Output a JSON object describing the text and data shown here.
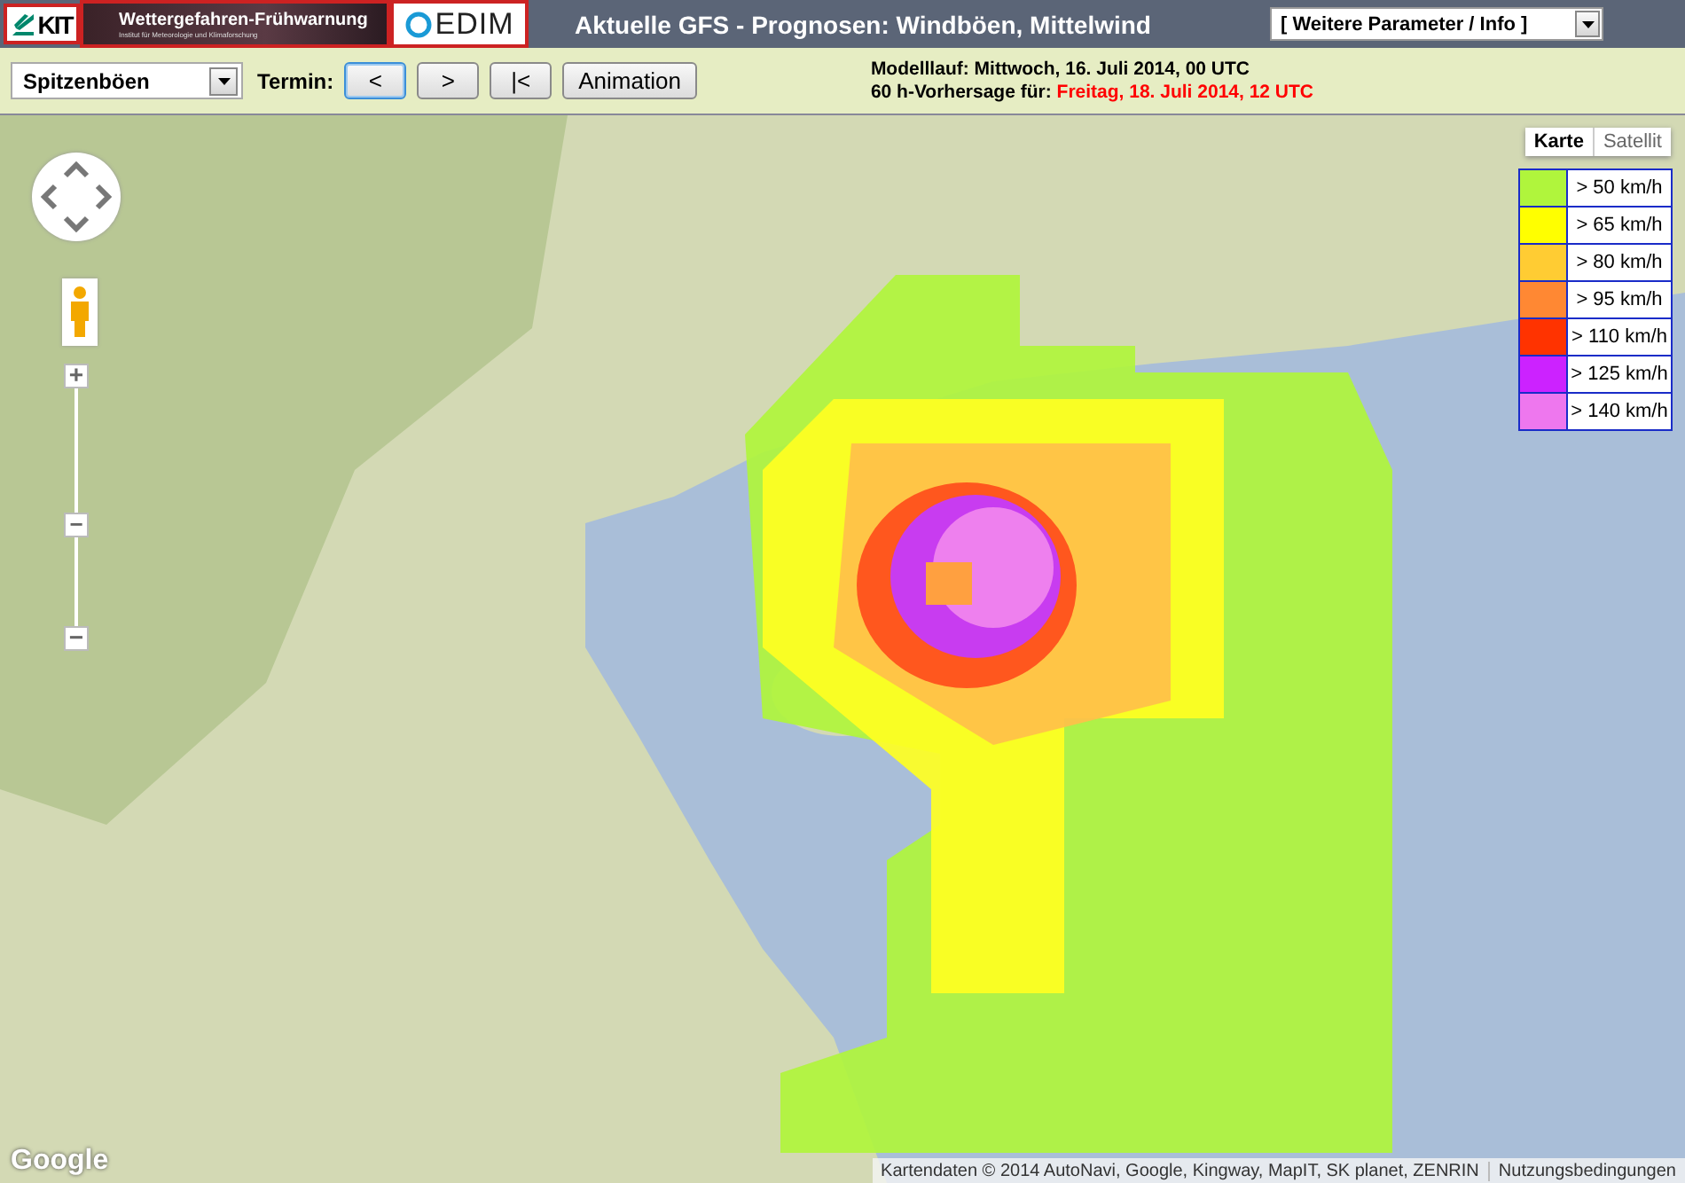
{
  "header": {
    "logos": {
      "kit": "KIT",
      "banner_title": "Wettergefahren-Frühwarnung",
      "banner_subtitle": "Institut für Meteorologie und Klimaforschung",
      "cedim": "EDIM"
    },
    "title": "Aktuelle GFS - Prognosen: Windböen, Mittelwind",
    "dropdown": "[ Weitere Parameter / Info ]"
  },
  "toolbar": {
    "parameter_select": "Spitzenböen",
    "termin_label": "Termin:",
    "buttons": [
      {
        "label": "<",
        "focused": true
      },
      {
        "label": ">",
        "focused": false
      },
      {
        "label": "|<",
        "focused": false
      },
      {
        "label": "Animation",
        "focused": false
      }
    ],
    "model_run_label": "Modelllauf:",
    "model_run": "Mittwoch, 16. Juli 2014, 00 UTC",
    "forecast_label": "60 h-Vorhersage für:",
    "forecast_time": "Freitag, 18. Juli 2014, 12 UTC"
  },
  "map": {
    "zoom": {
      "plus": "+",
      "minus": "−",
      "level": 0.42
    },
    "map_types": [
      {
        "label": "Karte",
        "selected": true
      },
      {
        "label": "Satellit",
        "selected": false
      }
    ],
    "legend": [
      {
        "label": "> 50 km/h",
        "color": "#b0f53c"
      },
      {
        "label": "> 65 km/h",
        "color": "#ffff00"
      },
      {
        "label": "> 80 km/h",
        "color": "#ffcc33"
      },
      {
        "label": "> 95 km/h",
        "color": "#ff8833"
      },
      {
        "label": "> 110 km/h",
        "color": "#ff3300"
      },
      {
        "label": "> 125 km/h",
        "color": "#cc22ff"
      },
      {
        "label": "> 140 km/h",
        "color": "#ee77ee"
      }
    ],
    "google_logo": "Google",
    "attribution": "Kartendaten © 2014 AutoNavi, Google, Kingway, MapIT, SK planet, ZENRIN",
    "terms_link": "Nutzungsbedingungen"
  }
}
